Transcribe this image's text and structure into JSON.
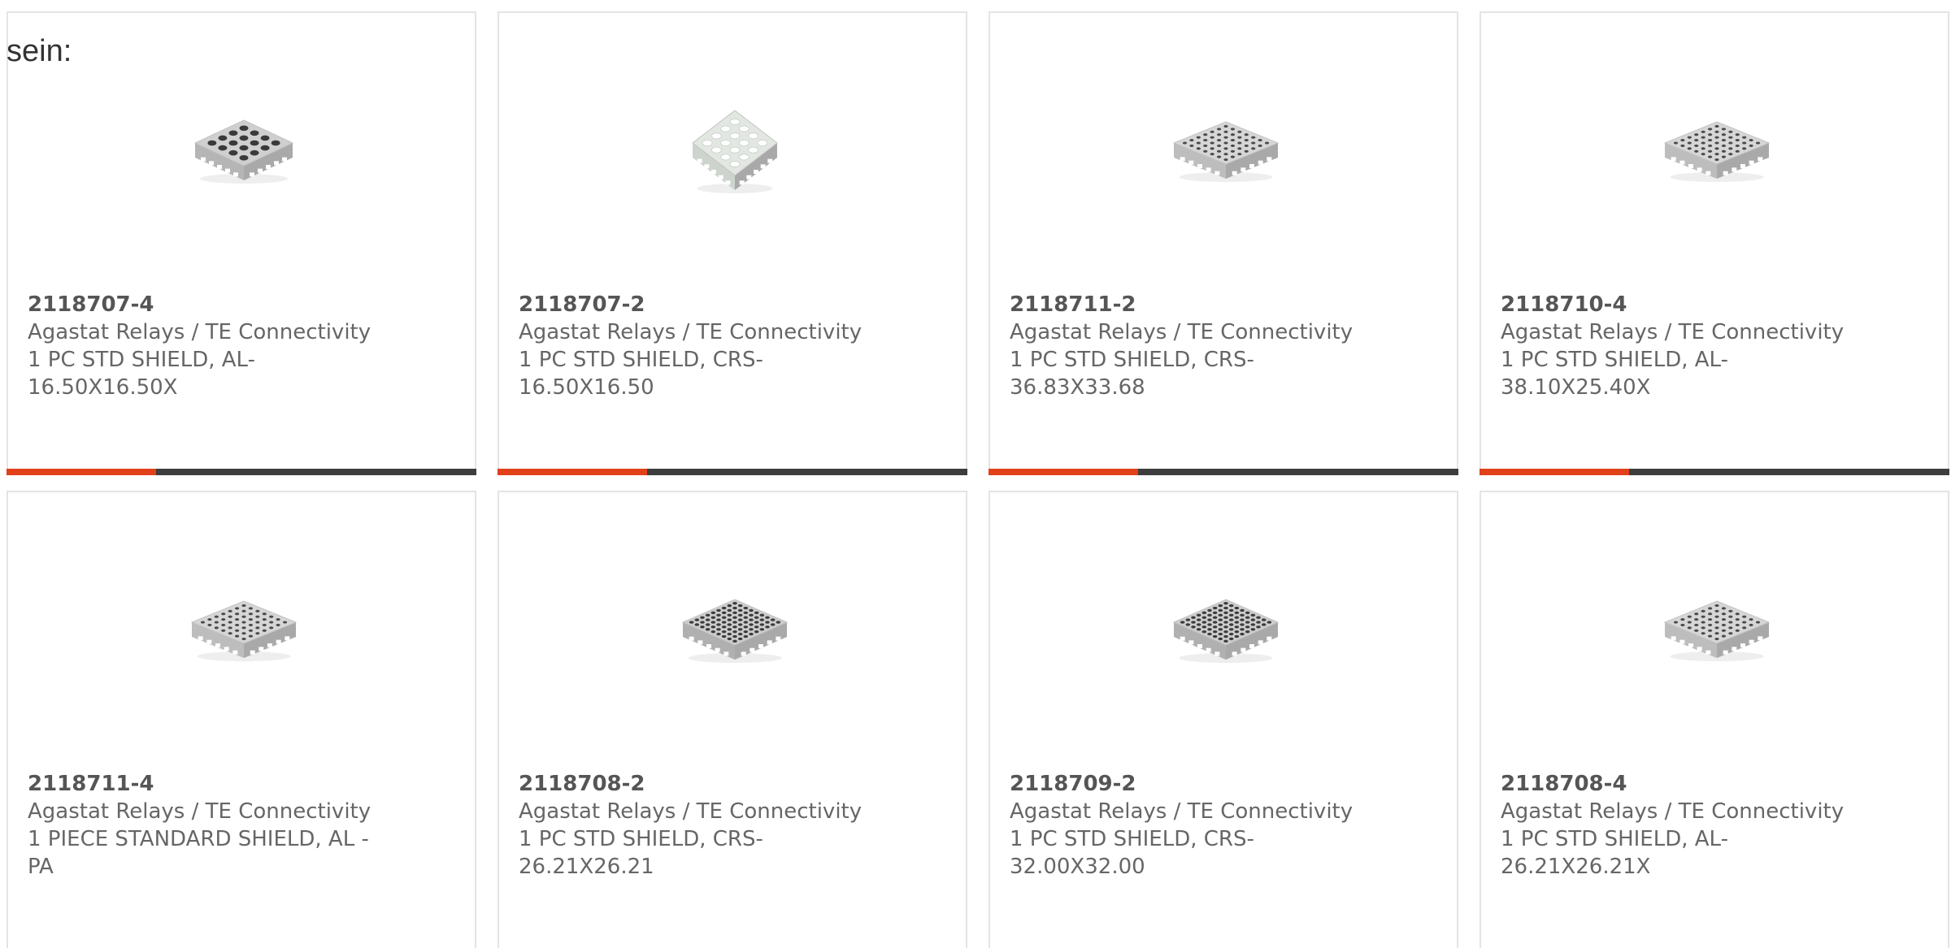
{
  "intro_text": "sein:",
  "colors": {
    "accent": "#e1401a",
    "bar_dark": "#3d3d3d",
    "text": "#666666",
    "part_number": "#555555",
    "card_border": "#e4e4e4"
  },
  "products": [
    {
      "part_number": "2118707-4",
      "manufacturer": "Agastat Relays / TE Connectivity",
      "desc_line1": "1 PC STD SHIELD, AL-",
      "desc_line2": "16.50X16.50X",
      "image": "shield-16-holes-icon"
    },
    {
      "part_number": "2118707-2",
      "manufacturer": "Agastat Relays / TE Connectivity",
      "desc_line1": "1 PC STD SHIELD, CRS-",
      "desc_line2": "16.50X16.50",
      "image": "shield-white-holes-icon"
    },
    {
      "part_number": "2118711-2",
      "manufacturer": "Agastat Relays / TE Connectivity",
      "desc_line1": "1 PC STD SHIELD, CRS-",
      "desc_line2": "36.83X33.68",
      "image": "shield-grid-holes-icon"
    },
    {
      "part_number": "2118710-4",
      "manufacturer": "Agastat Relays / TE Connectivity",
      "desc_line1": "1 PC STD SHIELD, AL-",
      "desc_line2": "38.10X25.40X",
      "image": "shield-grid-holes-icon"
    },
    {
      "part_number": "2118711-4",
      "manufacturer": "Agastat Relays / TE Connectivity",
      "desc_line1": "1 PIECE STANDARD SHIELD, AL -",
      "desc_line2": "PA",
      "image": "shield-grid-holes-icon"
    },
    {
      "part_number": "2118708-2",
      "manufacturer": "Agastat Relays / TE Connectivity",
      "desc_line1": "1 PC STD SHIELD, CRS-",
      "desc_line2": "26.21X26.21",
      "image": "shield-dense-holes-icon"
    },
    {
      "part_number": "2118709-2",
      "manufacturer": "Agastat Relays / TE Connectivity",
      "desc_line1": "1 PC STD SHIELD, CRS-",
      "desc_line2": "32.00X32.00",
      "image": "shield-dense-holes-icon"
    },
    {
      "part_number": "2118708-4",
      "manufacturer": "Agastat Relays / TE Connectivity",
      "desc_line1": "1 PC STD SHIELD, AL-",
      "desc_line2": "26.21X26.21X",
      "image": "shield-grid-holes-icon"
    }
  ]
}
